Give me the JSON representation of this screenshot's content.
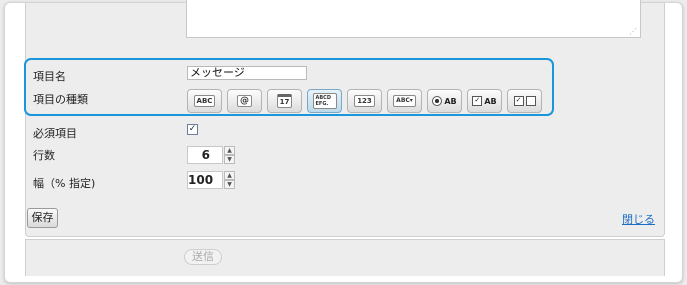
{
  "form": {
    "item_name_label": "項目名",
    "item_name_value": "メッセージ",
    "item_type_label": "項目の種類",
    "item_types": [
      {
        "glyph": "ABC",
        "icon": "text-field-icon",
        "selected": false
      },
      {
        "glyph": "@",
        "icon": "email-field-icon",
        "selected": false
      },
      {
        "glyph": "17",
        "icon": "date-field-icon",
        "selected": false
      },
      {
        "glyph": "ABCD EFG.",
        "icon": "textarea-field-icon",
        "selected": true
      },
      {
        "glyph": "123",
        "icon": "number-field-icon",
        "selected": false
      },
      {
        "glyph": "ABC▾",
        "icon": "select-field-icon",
        "selected": false
      },
      {
        "glyph": "AB",
        "icon": "radio-field-icon",
        "selected": false
      },
      {
        "glyph": "AB",
        "icon": "checkbox-field-icon",
        "selected": false
      },
      {
        "glyph": "",
        "icon": "multi-checkbox-field-icon",
        "selected": false
      }
    ],
    "required_label": "必須項目",
    "required_checked": true,
    "rows_label": "行数",
    "rows_value": "6",
    "width_label": "幅（% 指定)",
    "width_value": "100",
    "save_label": "保存",
    "close_label": "閉じる",
    "send_label": "送信"
  },
  "colors": {
    "highlight": "#1996dc",
    "link": "#1c6fc4"
  }
}
